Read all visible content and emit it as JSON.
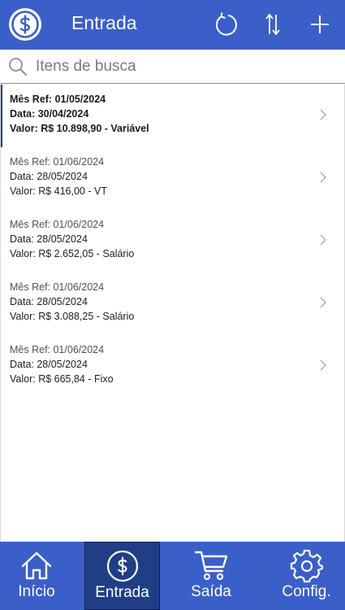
{
  "header": {
    "title": "Entrada",
    "logo_icon": "dollar-circle-icon",
    "actions": [
      {
        "icon": "refresh-icon"
      },
      {
        "icon": "sort-icon"
      },
      {
        "icon": "plus-icon"
      }
    ]
  },
  "search": {
    "placeholder": "Itens de busca",
    "value": ""
  },
  "list": {
    "items": [
      {
        "line1": "Mês Ref: 01/05/2024",
        "line2": "Data: 30/04/2024",
        "line3": "Valor: R$ 10.898,90 - Variável",
        "selected": true
      },
      {
        "line1": "Mês Ref: 01/06/2024",
        "line2": "Data: 28/05/2024",
        "line3": "Valor: R$ 416,00 - VT",
        "selected": false
      },
      {
        "line1": "Mês Ref: 01/06/2024",
        "line2": "Data: 28/05/2024",
        "line3": "Valor: R$ 2.652,05 - Salário",
        "selected": false
      },
      {
        "line1": "Mês Ref: 01/06/2024",
        "line2": "Data: 28/05/2024",
        "line3": "Valor: R$ 3.088,25 - Salário",
        "selected": false
      },
      {
        "line1": "Mês Ref: 01/06/2024",
        "line2": "Data: 28/05/2024",
        "line3": "Valor: R$ 665,84 - Fixo",
        "selected": false
      }
    ]
  },
  "nav": {
    "items": [
      {
        "label": "Início",
        "icon": "home-icon",
        "active": false
      },
      {
        "label": "Entrada",
        "icon": "dollar-circle-icon",
        "active": true
      },
      {
        "label": "Saída",
        "icon": "cart-icon",
        "active": false
      },
      {
        "label": "Config.",
        "icon": "gear-icon",
        "active": false
      }
    ]
  },
  "colors": {
    "brand": "#3b5fc8",
    "active_nav": "#203e86",
    "selected_border": "#1f3b8f"
  }
}
